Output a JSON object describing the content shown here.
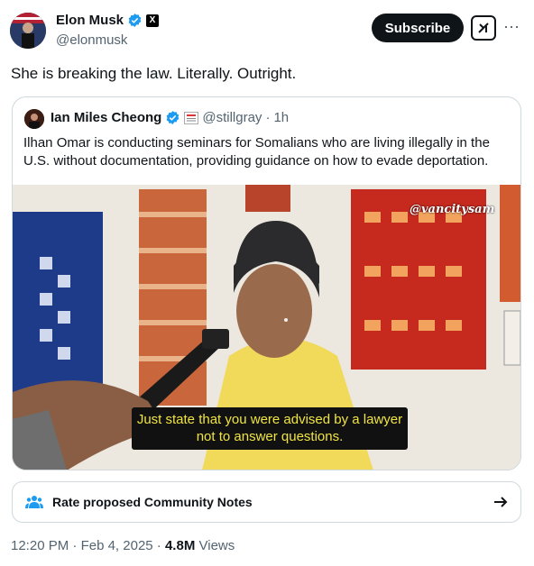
{
  "author": {
    "name": "Elon Musk",
    "handle": "@elonmusk",
    "verified": true,
    "affiliate_badge": "X"
  },
  "actions": {
    "subscribe_label": "Subscribe",
    "grok_icon": "grok-icon",
    "more_icon": "more-icon"
  },
  "tweet": {
    "text": "She is breaking the law. Literally. Outright."
  },
  "quote": {
    "name": "Ian Miles Cheong",
    "handle": "@stillgray",
    "separator": "·",
    "time": "1h",
    "text": "Ilhan Omar is conducting seminars for Somalians who are living illegally in the U.S. without documentation, providing guidance on how to evade deportation.",
    "media": {
      "watermark": "@vancitysam",
      "caption": "Just state that you were advised by a lawyer not to answer questions."
    }
  },
  "community_notes": {
    "label": "Rate proposed Community Notes"
  },
  "meta": {
    "time": "12:20 PM",
    "date": "Feb 4, 2025",
    "views_count": "4.8M",
    "views_label": "Views",
    "sep": "·"
  },
  "colors": {
    "accent_verified": "#1d9bf0",
    "text_primary": "#0f1419",
    "text_secondary": "#536471",
    "border": "#cfd9de",
    "caption_text": "#f0e442"
  }
}
